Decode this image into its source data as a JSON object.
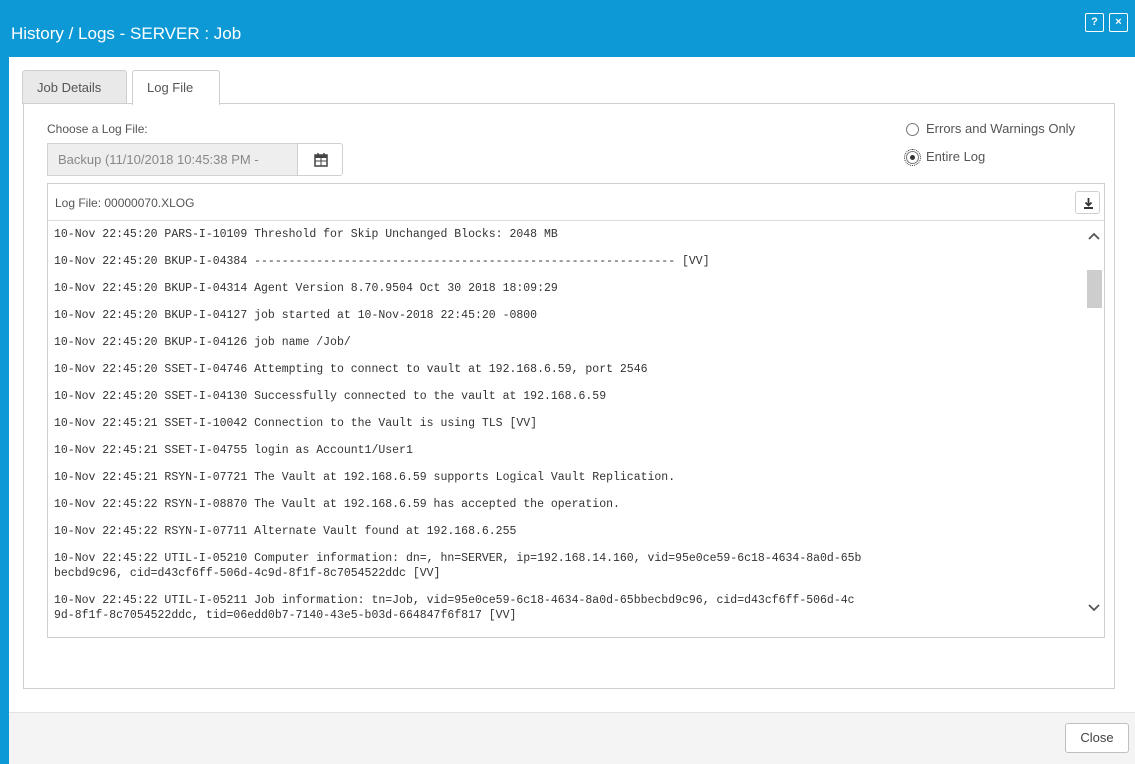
{
  "window": {
    "title": "History / Logs - SERVER : Job",
    "help_label": "?",
    "close_label": "×"
  },
  "tabs": [
    {
      "label": "Job Details",
      "active": false
    },
    {
      "label": "Log File",
      "active": true
    }
  ],
  "log_chooser": {
    "label": "Choose a Log File:",
    "value": "Backup (11/10/2018 10:45:38 PM - "
  },
  "filter": {
    "options": [
      {
        "label": "Errors and Warnings Only",
        "selected": false
      },
      {
        "label": "Entire Log",
        "selected": true
      }
    ]
  },
  "log": {
    "file_label": "Log File: 00000070.XLOG",
    "lines": [
      "10-Nov 22:45:20 PARS-I-10109 Threshold for Skip Unchanged Blocks: 2048 MB",
      "10-Nov 22:45:20 BKUP-I-04384 ------------------------------------------------------------- [VV]",
      "10-Nov 22:45:20 BKUP-I-04314 Agent Version 8.70.9504 Oct 30 2018 18:09:29",
      "10-Nov 22:45:20 BKUP-I-04127 job started at 10-Nov-2018 22:45:20 -0800",
      "10-Nov 22:45:20 BKUP-I-04126 job name /Job/",
      "10-Nov 22:45:20 SSET-I-04746 Attempting to connect to vault at 192.168.6.59, port 2546",
      "10-Nov 22:45:20 SSET-I-04130 Successfully connected to the vault at 192.168.6.59",
      "10-Nov 22:45:21 SSET-I-10042 Connection to the Vault is using TLS [VV]",
      "10-Nov 22:45:21 SSET-I-04755 login as Account1/User1",
      "10-Nov 22:45:21 RSYN-I-07721 The Vault at 192.168.6.59 supports Logical Vault Replication.",
      "10-Nov 22:45:22 RSYN-I-08870 The Vault at 192.168.6.59 has accepted the operation.",
      "10-Nov 22:45:22 RSYN-I-07711 Alternate Vault found at 192.168.6.255",
      "10-Nov 22:45:22 UTIL-I-05210 Computer information: dn=, hn=SERVER, ip=192.168.14.160, vid=95e0ce59-6c18-4634-8a0d-65b\nbecbd9c96, cid=d43cf6ff-506d-4c9d-8f1f-8c7054522ddc [VV]",
      "10-Nov 22:45:22 UTIL-I-05211 Job information: tn=Job, vid=95e0ce59-6c18-4634-8a0d-65bbecbd9c96, cid=d43cf6ff-506d-4c\n9d-8f1f-8c7054522ddc, tid=06edd0b7-7140-43e5-b03d-664847f6f817 [VV]"
    ]
  },
  "footer": {
    "close_label": "Close"
  },
  "colors": {
    "accent": "#0c99d6",
    "scrollbar_thumb": "#cdcdcd"
  },
  "icons": [
    "help-icon",
    "close-icon",
    "calendar-icon",
    "download-icon",
    "chevron-up-icon",
    "chevron-down-icon"
  ]
}
